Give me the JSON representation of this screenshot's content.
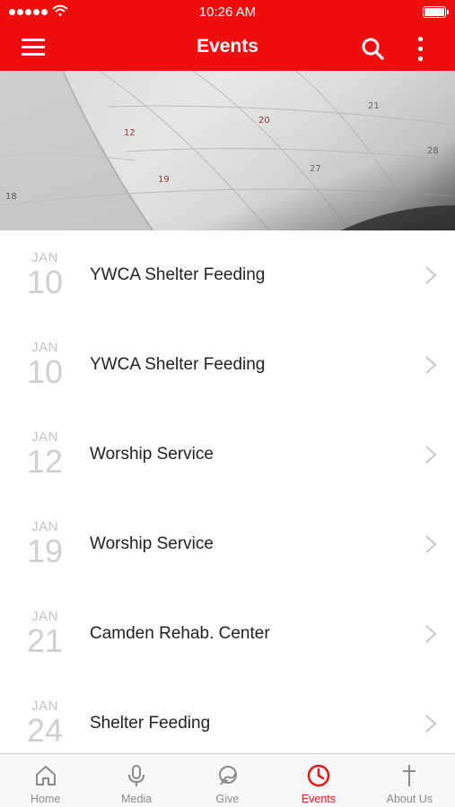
{
  "status_bar": {
    "time": "10:26 AM"
  },
  "header": {
    "title": "Events",
    "menu_icon": "hamburger-menu-icon",
    "search_icon": "search-icon",
    "more_icon": "more-vertical-icon"
  },
  "colors": {
    "brand": "#f00d0d",
    "active_tab": "#e0191b",
    "date_text": "#c4c4c4"
  },
  "hero": {
    "image": "calendar-photo",
    "visible_numbers": [
      "20",
      "21",
      "27",
      "28",
      "18",
      "19",
      "12"
    ]
  },
  "events": [
    {
      "month": "JAN",
      "day": "10",
      "title": "YWCA Shelter Feeding"
    },
    {
      "month": "JAN",
      "day": "10",
      "title": "YWCA Shelter Feeding"
    },
    {
      "month": "JAN",
      "day": "12",
      "title": "Worship Service"
    },
    {
      "month": "JAN",
      "day": "19",
      "title": "Worship Service"
    },
    {
      "month": "JAN",
      "day": "21",
      "title": "Camden Rehab. Center"
    },
    {
      "month": "JAN",
      "day": "24",
      "title": "Shelter Feeding"
    }
  ],
  "tabs": [
    {
      "label": "Home",
      "icon": "home-icon",
      "active": false
    },
    {
      "label": "Media",
      "icon": "microphone-icon",
      "active": false
    },
    {
      "label": "Give",
      "icon": "give-icon",
      "active": false
    },
    {
      "label": "Events",
      "icon": "clock-icon",
      "active": true
    },
    {
      "label": "About Us",
      "icon": "cross-icon",
      "active": false
    }
  ]
}
